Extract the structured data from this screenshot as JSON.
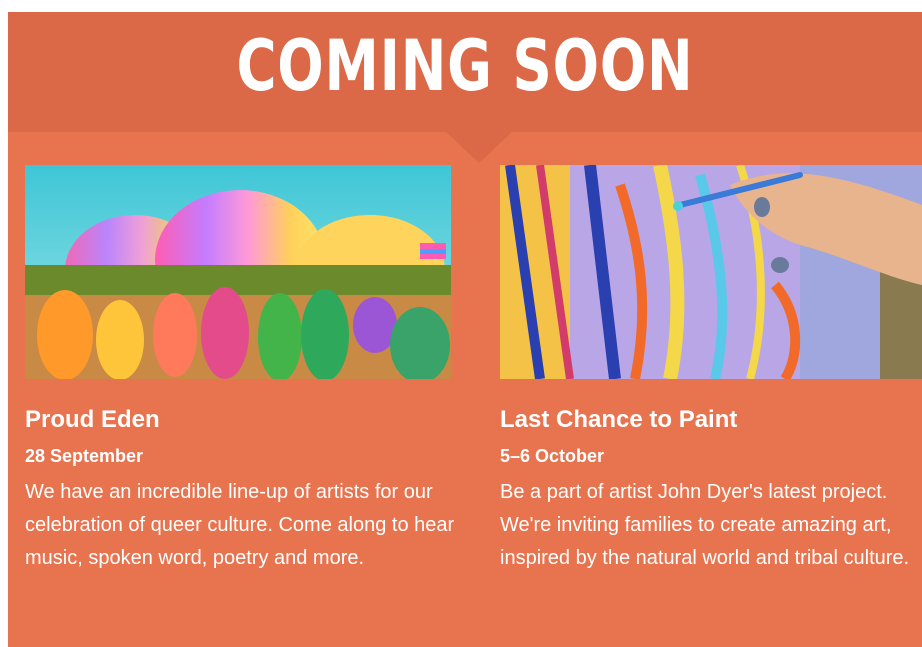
{
  "colors": {
    "background": "#e8734f",
    "banner": "#db6846",
    "text": "#ffffff"
  },
  "banner": {
    "title": "COMING SOON"
  },
  "events": [
    {
      "image": "rainbow-domes-crowd-image",
      "title": "Proud Eden",
      "date": "28 September",
      "description": "We have an incredible line-up of artists for our celebration of queer culture. Come along to hear music, spoken word, poetry and more."
    },
    {
      "image": "hand-painting-canvas-image",
      "title": "Last Chance to Paint",
      "date": "5–6 October",
      "description": "Be a part of artist John Dyer's latest project. We're inviting families to create amazing art, inspired by the natural world and tribal culture."
    }
  ]
}
